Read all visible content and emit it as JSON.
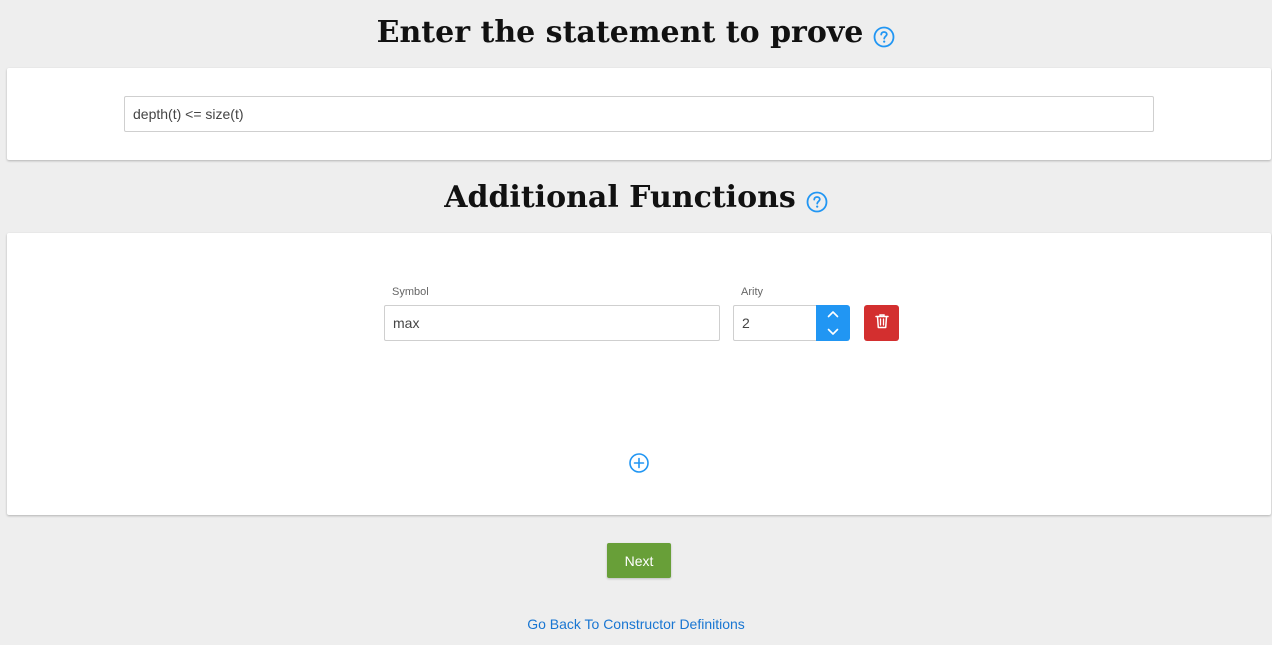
{
  "statement_section": {
    "title": "Enter the statement to prove",
    "help_icon": "question-circle-icon",
    "statement_value": "depth(t) <= size(t)"
  },
  "functions_section": {
    "title": "Additional Functions",
    "help_icon": "question-circle-icon",
    "symbol_label": "Symbol",
    "arity_label": "Arity",
    "rows": [
      {
        "symbol": "max",
        "arity": "2"
      }
    ],
    "delete_icon": "trash-icon",
    "add_icon": "plus-circle-icon"
  },
  "actions": {
    "next_label": "Next",
    "back_link_label": "Go Back To Constructor Definitions"
  },
  "colors": {
    "accent_blue": "#2196f3",
    "delete_red": "#d32f2f",
    "next_green": "#689f38",
    "link_blue": "#1976d2",
    "background": "#eeeeee"
  }
}
